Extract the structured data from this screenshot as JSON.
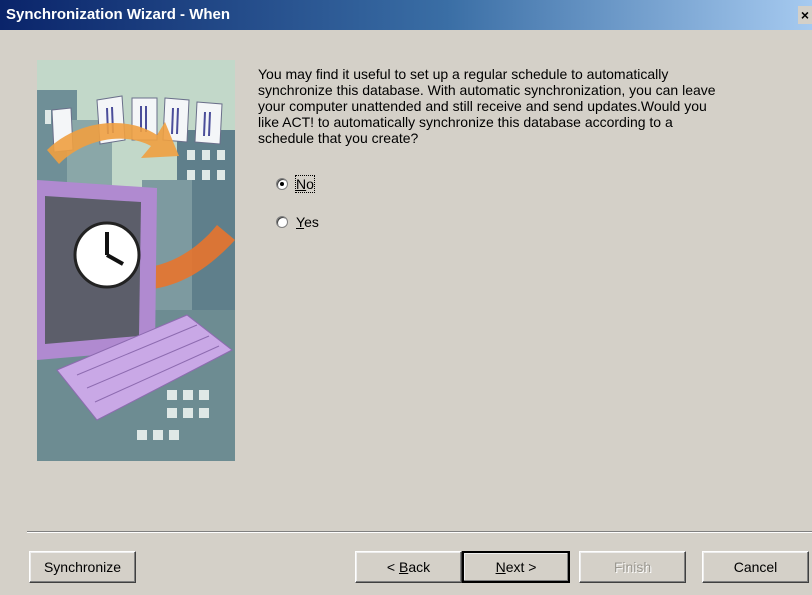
{
  "window": {
    "title": "Synchronization Wizard - When",
    "close_glyph": "×"
  },
  "content": {
    "question": "You may find it useful to set up a regular schedule to automatically synchronize this database.  With automatic synchronization, you can leave your computer unattended and still receive and send updates.Would you like ACT! to automatically synchronize this database according to a schedule that you create?"
  },
  "options": {
    "no": {
      "mnemonic": "N",
      "rest": "o",
      "selected": true
    },
    "yes": {
      "mnemonic": "Y",
      "rest": "es",
      "selected": false
    }
  },
  "buttons": {
    "synchronize": "Synchronize",
    "back": {
      "prefix": "< ",
      "mnemonic": "B",
      "rest": "ack"
    },
    "next": {
      "mnemonic": "N",
      "rest": "ext >"
    },
    "finish": "Finish",
    "cancel": "Cancel"
  },
  "illustration": {
    "icon": "clock-computer-illustration"
  },
  "colors": {
    "titlebar_start": "#0a246a",
    "titlebar_end": "#a6caf0",
    "dialog_bg": "#d4d0c8"
  }
}
